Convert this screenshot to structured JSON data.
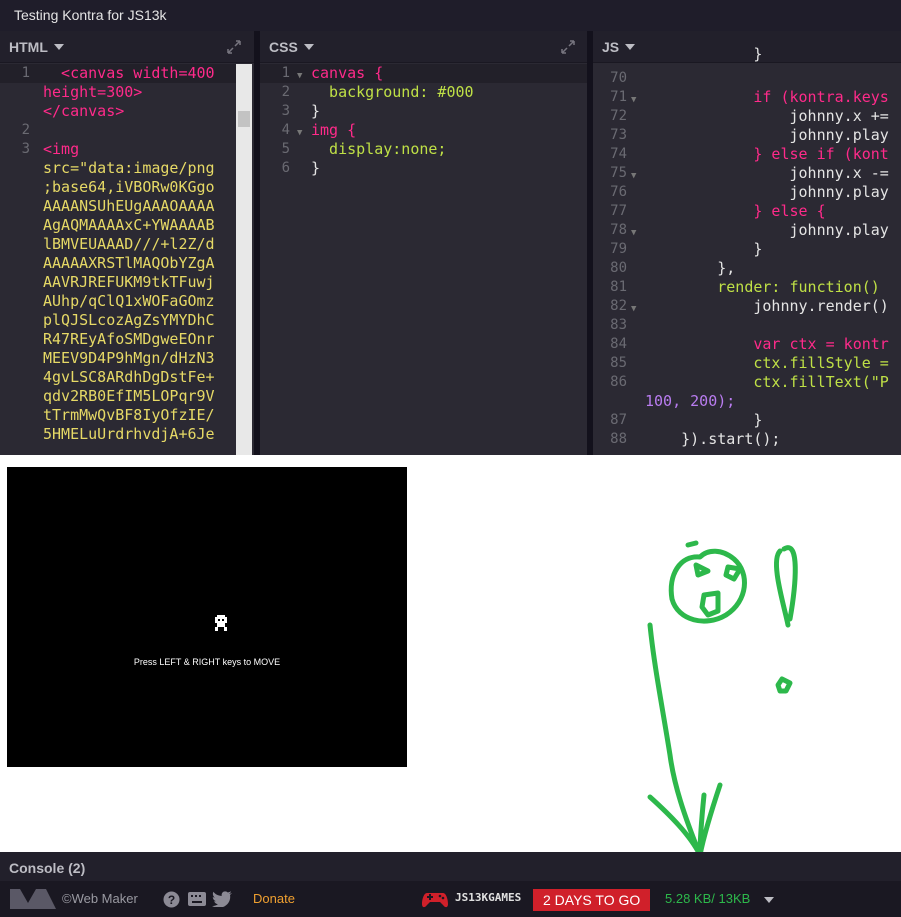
{
  "window": {
    "title": "Testing Kontra for JS13k"
  },
  "panes": {
    "html": {
      "label": "HTML"
    },
    "css": {
      "label": "CSS"
    },
    "js": {
      "label": "JS"
    }
  },
  "html_code": {
    "line_numbers": [
      "1",
      "2",
      "3"
    ],
    "lines": [
      "  <canvas width=400",
      "height=300>",
      "</canvas>",
      "",
      "<img",
      "src=\"data:image/png",
      ";base64,iVBORw0KGgo",
      "AAAANSUhEUgAAAOAAAA",
      "AgAQMAAAAxC+YWAAAAB",
      "lBMVEUAAAD///+l2Z/d",
      "AAAAAXRSTlMAQObYZgA",
      "AAVRJREFUKM9tkTFuwj",
      "AUhp/qClQ1xWOFaGOmz",
      "plQJSLcozAgZsYMYDhC",
      "R47REyAfoSMDgweEOnr",
      "MEEV9D4P9hMgn/dHzN3",
      "4gvLSC8ARdhDgDstFe+",
      "qdv2RB0EfIM5LOPqr9V",
      "tTrmMwQvBF8IyOfzIE/",
      "5HMELuUrdrhvdjA+6Je"
    ]
  },
  "css_code": {
    "line_numbers": [
      "1",
      "2",
      "3",
      "4",
      "5",
      "6"
    ],
    "lines": [
      "canvas {",
      "  background: #000",
      "}",
      "img {",
      "  display:none;",
      "}"
    ]
  },
  "js_code": {
    "line_numbers": [
      "70",
      "71",
      "72",
      "73",
      "74",
      "75",
      "76",
      "77",
      "78",
      "79",
      "80",
      "81",
      "82",
      "83",
      "84",
      "85",
      "86",
      "87",
      "88"
    ],
    "lines": [
      "            }",
      "",
      "            if (kontra.keys",
      "                johnny.x +=",
      "                johnny.play",
      "            } else if (kont",
      "                johnny.x -=",
      "                johnny.play",
      "            } else {",
      "                johnny.play",
      "            }",
      "        },",
      "        render: function()",
      "            johnny.render()",
      "",
      "            var ctx = kontr",
      "            ctx.fillStyle =",
      "            ctx.fillText(\"P",
      "100, 200);",
      "            }",
      "    }).start();"
    ]
  },
  "preview": {
    "game_message": "Press LEFT & RIGHT keys to MOVE"
  },
  "console": {
    "label": "Console (2)"
  },
  "footer": {
    "brand": "©Web Maker",
    "donate": "Donate",
    "js13k": "JS13KGAMES",
    "countdown": "2 DAYS TO GO",
    "size": "5.28 KB/ 13KB"
  },
  "colors": {
    "accent_green": "#2db84b",
    "countdown_red": "#d0202a",
    "donate": "#f0a030"
  }
}
